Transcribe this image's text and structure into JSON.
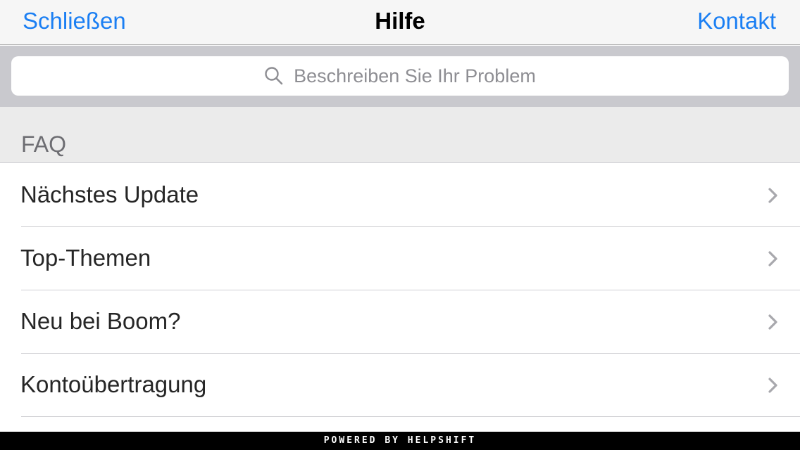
{
  "navbar": {
    "left_label": "Schließen",
    "title": "Hilfe",
    "right_label": "Kontakt"
  },
  "search": {
    "placeholder": "Beschreiben Sie Ihr Problem",
    "icon": "search-icon"
  },
  "section": {
    "title": "FAQ"
  },
  "faq_items": [
    {
      "label": "Nächstes Update",
      "icon": "chevron-right-icon"
    },
    {
      "label": "Top-Themen",
      "icon": "chevron-right-icon"
    },
    {
      "label": "Neu bei Boom?",
      "icon": "chevron-right-icon"
    },
    {
      "label": "Kontoübertragung",
      "icon": "chevron-right-icon"
    }
  ],
  "footer": {
    "text": "POWERED BY HELPSHIFT"
  },
  "colors": {
    "accent": "#1b7ff3",
    "navbar_bg": "#f6f6f6",
    "search_bar_bg": "#c9c9ce",
    "section_bg": "#ebebeb",
    "footer_bg": "#000000"
  }
}
